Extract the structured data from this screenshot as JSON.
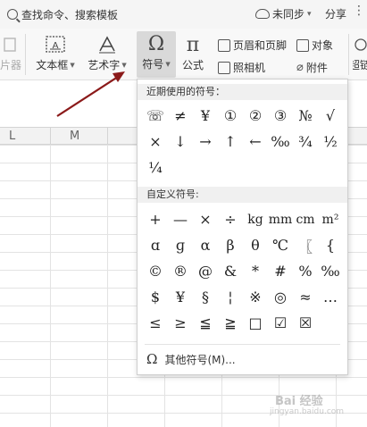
{
  "topbar": {
    "search_label": "查找命令、搜索模板",
    "sync_label": "未同步",
    "share_label": "分享",
    "more_label": "⋮"
  },
  "ribbon": {
    "partial_left_label": "片器",
    "textbox_label": "文本框",
    "wordart_label": "艺术字",
    "symbol_label": "符号",
    "formula_label": "公式",
    "header_footer_label": "页眉和页脚",
    "object_label": "对象",
    "camera_label": "照相机",
    "attachment_label": "附件",
    "partial_right_label": "超链"
  },
  "sheet": {
    "columns": [
      "L",
      "M"
    ]
  },
  "symbol_popup": {
    "recent_title": "近期使用的符号：",
    "recent_symbols": [
      "☏",
      "≠",
      "¥",
      "①",
      "②",
      "③",
      "№",
      "√",
      "×",
      "↓",
      "→",
      "↑",
      "←",
      "‰",
      "¾",
      "½",
      "¼"
    ],
    "custom_title": "自定义符号:",
    "custom_symbols": [
      "+",
      "—",
      "×",
      "÷",
      "kg",
      "mm",
      "cm",
      "m²",
      "ɑ",
      "ɡ",
      "α",
      "β",
      "θ",
      "℃",
      "〖",
      "{",
      "©",
      "®",
      "@",
      "&",
      "*",
      "#",
      "%",
      "‰",
      "$",
      "¥",
      "§",
      "¦",
      "※",
      "◎",
      "≈",
      "…",
      "≤",
      "≥",
      "≦",
      "≧",
      "□",
      "☑",
      "☒"
    ],
    "more_symbols_label": "其他符号(M)..."
  },
  "watermark": {
    "text": "Bai 经验",
    "sub": "jingyan.baidu.com"
  }
}
